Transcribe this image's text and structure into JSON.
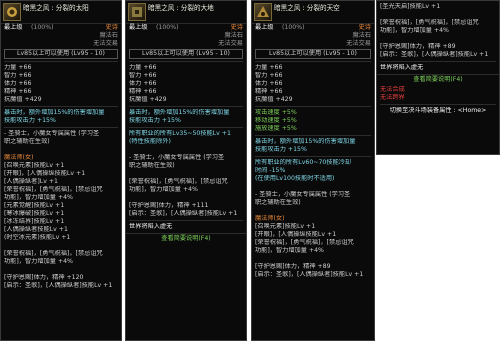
{
  "panels": [
    {
      "title": "暗黑之风 : 分裂的太阳",
      "grade": "最上级",
      "grade_pct": "(100%)",
      "rarity": "史诗",
      "item_type": "魔法石",
      "trade": "无法交易",
      "level_req": "Lv85以上可以使用 (Lv95 - 10)",
      "stats": [
        {
          "name": "力量",
          "val": "+66"
        },
        {
          "name": "智力",
          "val": "+66"
        },
        {
          "name": "体力",
          "val": "+66"
        },
        {
          "name": "精神",
          "val": "+66"
        },
        {
          "name": "抗魔值",
          "val": "+429"
        }
      ],
      "effects": [
        "暴击时，额外增加15%的伤害增加量",
        "技能攻击力 +15%"
      ],
      "lines": [
        "- 圣骑士，小魔女专属属性 (学习圣",
        "  职之辅助在生效)",
        "",
        "魔法师(女)",
        "[召唤元素]技能Lv +1",
        "[开眼]，[人偶操纵技能Lv +1",
        "[人偶操纵者]Lv +1",
        "[荣誉祝福]，[勇气祝福]，[禁忌诅咒",
        "功能]，智力增加量 +4%",
        "[元素觉醒]技能Lv +1",
        "[寒冰爆破]技能Lv +1",
        "[冰冻结界]技能Lv +1",
        "[人偶操纵者技能Lv +1",
        "(时空冰元素)技能Lv +1",
        "",
        "[荣誉祝福]，[勇气祝福]，[禁忌诅咒",
        "功能]，智力增加量 +4%",
        "",
        "[守护恩赐]体力，精神 +120",
        "[启示：圣歌]，[人偶操纵者]技能Lv +1"
      ]
    },
    {
      "title": "暗黑之风 : 分裂的大地",
      "grade": "最上级",
      "grade_pct": "(100%)",
      "rarity": "史诗",
      "item_type": "魔法石",
      "trade": "无法交易",
      "level_req": "Lv85以上可以使用 (Lv95 - 10)",
      "stats": [
        {
          "name": "力量",
          "val": "+66"
        },
        {
          "name": "智力",
          "val": "+66"
        },
        {
          "name": "体力",
          "val": "+66"
        },
        {
          "name": "精神",
          "val": "+66"
        },
        {
          "name": "抗魔值",
          "val": "+429"
        }
      ],
      "effects": [
        "暴击时，额外增加15%的伤害增加量",
        "技能攻击力 +15%"
      ],
      "lines": [
        "所有职业的所有Lv35~50技能Lv +1",
        "(特性技能除外)",
        "",
        "- 圣骑士，小魔女专属属性 (学习圣",
        "  职之辅助在生效)",
        "",
        "[荣誉祝福]，[勇气祝福]，[禁忌诅咒",
        "功能]，智力增加量 +4%",
        "",
        "[守护恩赐]体力，精神 +111",
        "[启示：圣歌]，[人偶操纵者]技能Lv +1"
      ],
      "footer_note": "世界将陷入虚无",
      "footer_btn": "查看简要说明(F4)"
    },
    {
      "title": "暗黑之风 : 分裂的天空",
      "grade": "最上级",
      "grade_pct": "(100%)",
      "rarity": "史诗",
      "item_type": "魔法石",
      "trade": "无法交易",
      "level_req": "Lv85以上可以使用 (Lv95 - 10)",
      "stats": [
        {
          "name": "力量",
          "val": "+66"
        },
        {
          "name": "智力",
          "val": "+66"
        },
        {
          "name": "体力",
          "val": "+66"
        },
        {
          "name": "精神",
          "val": "+66"
        },
        {
          "name": "抗魔值",
          "val": "+429"
        }
      ],
      "speeds": [
        "攻击速度 +5%",
        "移动速度 +5%",
        "施放速度 +5%"
      ],
      "effects": [
        "暴击时，额外增加15%的伤害增加量",
        "技能攻击力 +15%"
      ],
      "lines": [
        "所有职业的所有Lv60~70技能冷却",
        "时间 -15%",
        "(在使用Lv100技能时不适用)",
        "",
        "- 圣骑士，小魔女专属属性 (学习圣",
        "  职之辅助在生效)",
        "",
        "魔法师(女)",
        "[召唤元素]技能Lv +1",
        "[开眼]，[人偶操纵技能Lv +1",
        "[荣誉祝福]，[勇气祝福]，[禁忌诅咒",
        "功能]，智力增加量 +4%",
        "",
        "[守护恩赐]体力，精神 +89",
        "[启示：圣歌]，[人偶操纵者]技能Lv +1"
      ]
    }
  ],
  "panel4": {
    "lines": [
      "[圣光天启]技能Lv +1",
      "",
      "[荣誉祝福]，[勇气祝福]，[禁忌诅咒",
      "功能]，智力增加量 +4%",
      "",
      "[守护恩赐]体力，精神 +89",
      "[启示：圣歌]，[人偶操纵者]技能Lv +1"
    ],
    "footer_note": "世界将陷入虚无",
    "footer_btn": "查看简要说明(F4)",
    "warn1": "无法合成",
    "warn2": "无法跨界",
    "compare": "切换至决斗场装备属性 : <Home>"
  }
}
